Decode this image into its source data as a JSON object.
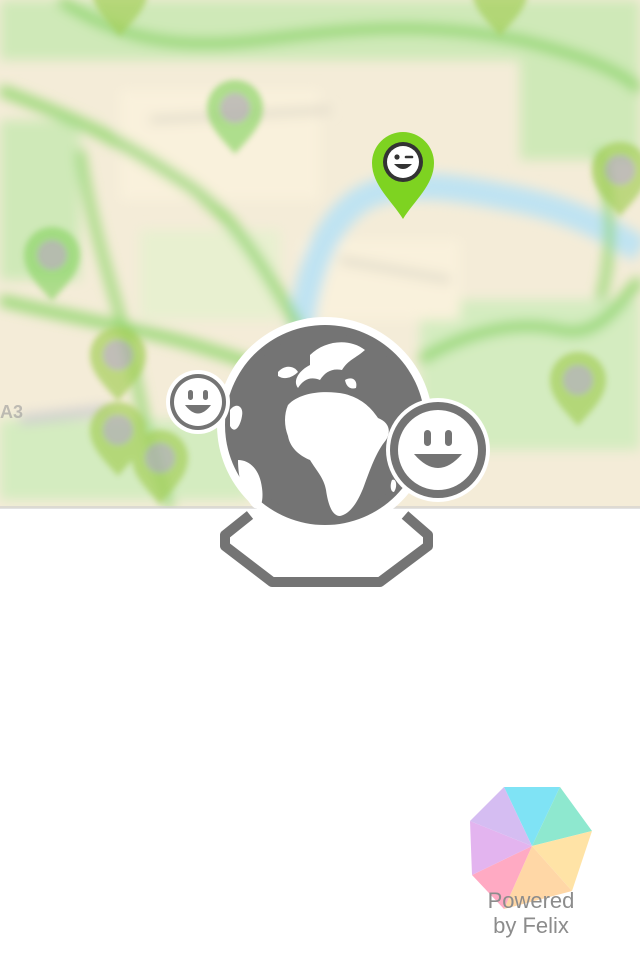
{
  "screen": {
    "background_color": "#ffffff"
  },
  "map": {
    "pin_color": "#7ed321",
    "water_color": "#bfe3f2",
    "land_color": "#f7efd8",
    "park_color": "#bfe6a6",
    "active_pin_icon": "winking-smiley-icon",
    "partial_label": "A3"
  },
  "emblem": {
    "primary_color": "#747474",
    "globe_icon": "globe-icon",
    "left_avatar_icon": "smiley-icon",
    "right_avatar_icon": "smiley-icon",
    "stand_icon": "globe-stand-icon"
  },
  "branding": {
    "logo_icon": "felix-pentagon-logo-icon",
    "line1": "Powered",
    "line2": "by Felix",
    "text_color": "#8c8c8c"
  }
}
